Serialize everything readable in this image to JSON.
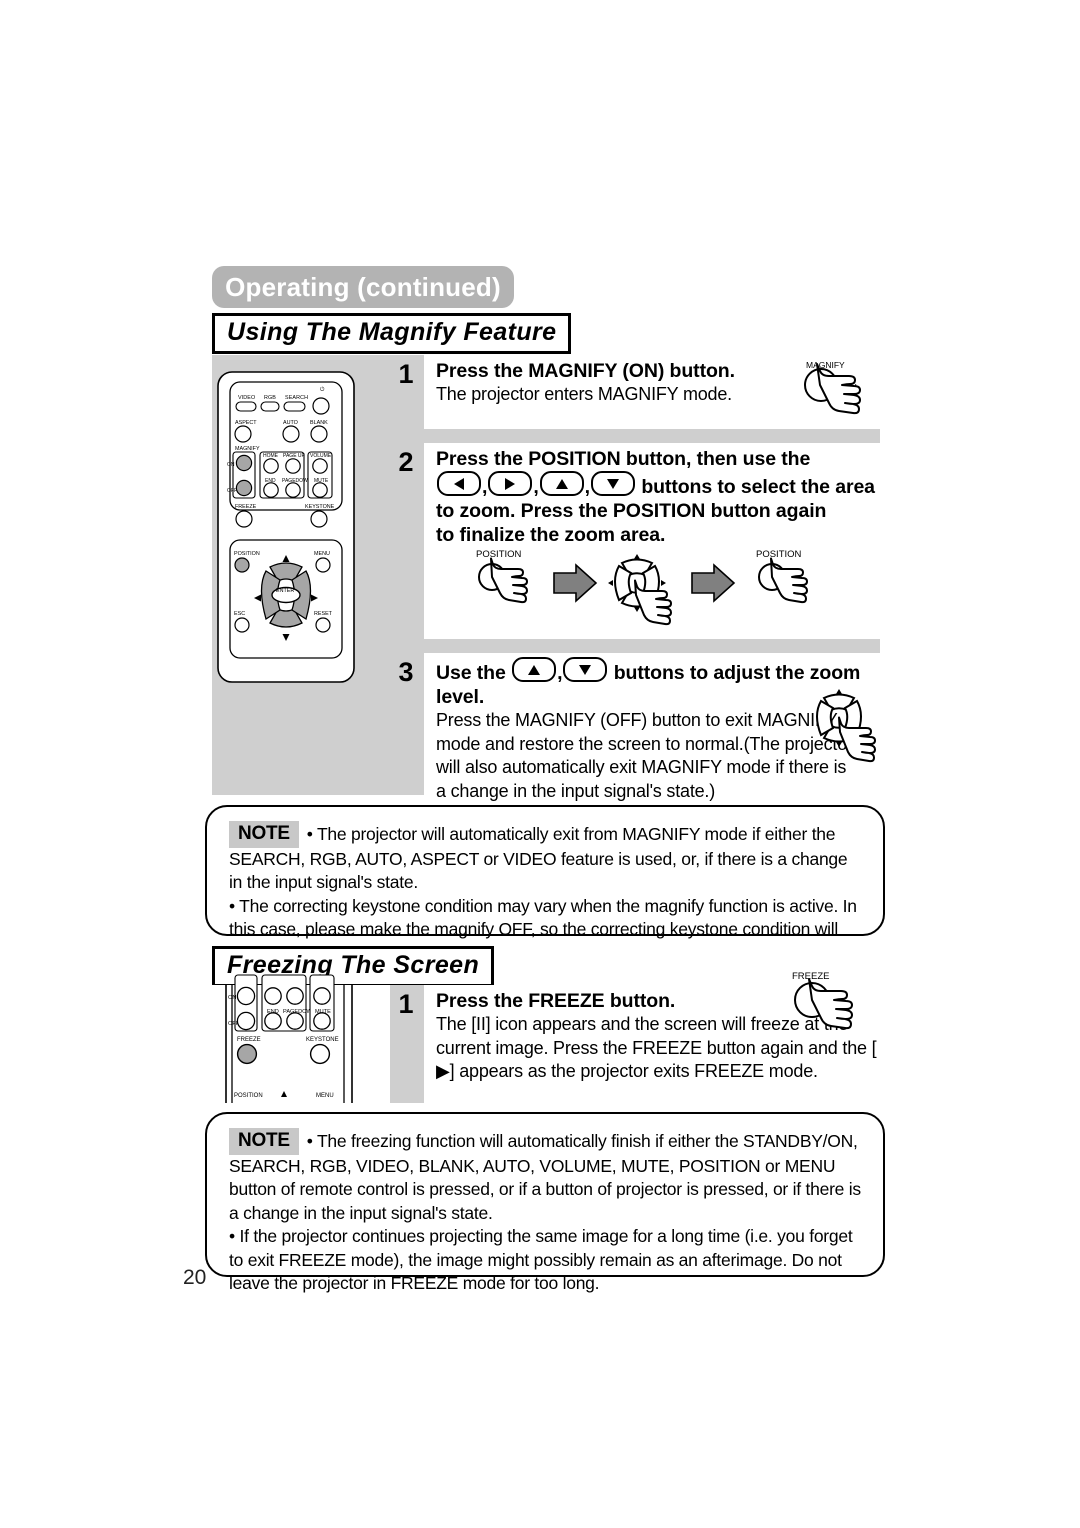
{
  "header": {
    "title": "Operating (continued)"
  },
  "sections": [
    {
      "id": "magnify",
      "heading": "Using The Magnify Feature"
    },
    {
      "id": "freeze",
      "heading": "Freezing The Screen"
    }
  ],
  "magnify_steps": [
    {
      "number": "1",
      "title": "Press the MAGNIFY (ON) button.",
      "desc": "The projector enters MAGNIFY mode."
    },
    {
      "number": "2",
      "title_part1": "Press the POSITION button, then use the",
      "title_part2": "buttons to select the area",
      "title_part3": "to zoom. Press the POSITION button again",
      "title_part4": "to finalize the zoom area."
    },
    {
      "number": "3",
      "title_part1": "Use the",
      "title_part2": "buttons to adjust the zoom",
      "title_part3": "level.",
      "desc": "Press the MAGNIFY (OFF) button to exit MAGNIFY mode and restore the screen to normal.(The projector will also automatically exit MAGNIFY mode if there is a change in the input signal's state.)"
    }
  ],
  "freeze_steps": [
    {
      "number": "1",
      "title": "Press the FREEZE button.",
      "desc": "The [II] icon appears and the screen will freeze at the current image. Press the FREEZE button again and the [ ▶] appears as the projector exits FREEZE mode."
    }
  ],
  "illustrations": {
    "magnify_button": {
      "label_top": "MAGNIFY",
      "label_side": "ON"
    },
    "position_button_1": {
      "label": "POSITION"
    },
    "position_button_2": {
      "label": "POSITION"
    },
    "freeze_button": {
      "label": "FREEZE"
    }
  },
  "remote_full": {
    "row1": [
      "VIDEO",
      "RGB",
      "SEARCH"
    ],
    "power": "⏻",
    "row2": [
      "ASPECT",
      "AUTO",
      "BLANK"
    ],
    "magnify_group": {
      "label": "MAGNIFY",
      "on": "ON",
      "off": "OFF"
    },
    "nav_group": [
      "HOME",
      "PAGE UP",
      "END",
      "PAGE DOWN"
    ],
    "vol_group": [
      "VOLUME",
      "MUTE"
    ],
    "row3": [
      "FREEZE",
      "KEYSTONE"
    ],
    "lower": [
      "POSITION",
      "MENU",
      "ESC",
      "RESET"
    ],
    "enter": "ENTER"
  },
  "remote_crop": {
    "magnify_on": "ON",
    "magnify_off": "OFF",
    "nav": [
      "END",
      "PAGE DOWN"
    ],
    "mute": "MUTE",
    "freeze": "FREEZE",
    "keystone": "KEYSTONE",
    "position": "POSITION",
    "menu": "MENU"
  },
  "notes": [
    {
      "badge": "NOTE",
      "lines": [
        "• The projector will automatically exit from MAGNIFY mode if either the SEARCH, RGB, AUTO, ASPECT or VIDEO feature is used, or, if there is a change in the input signal's state.",
        "• The correcting keystone condition may vary when the magnify function is active. In this case, please make the magnify OFF, so the correcting keystone condition will be restored."
      ]
    },
    {
      "badge": "NOTE",
      "lines": [
        "• The freezing function will automatically finish if either the STANDBY/ON, SEARCH, RGB, VIDEO, BLANK, AUTO, VOLUME, MUTE, POSITION or MENU button of remote control is pressed, or if a button of projector is pressed, or if there is a change in the input signal's state.",
        "• If the projector continues projecting the same image for a long time (i.e. you forget to exit FREEZE mode), the image might possibly remain as an afterimage. Do not leave the projector in FREEZE mode for too long."
      ]
    }
  ],
  "footer": {
    "page_number": "20"
  },
  "colors": {
    "title_pill": "#b3b3b3",
    "panel_gray": "#cfcfcf",
    "badge_gray": "#c8c8c8",
    "arrow_gray": "#808080",
    "key_gray": "#a6a6a6"
  }
}
